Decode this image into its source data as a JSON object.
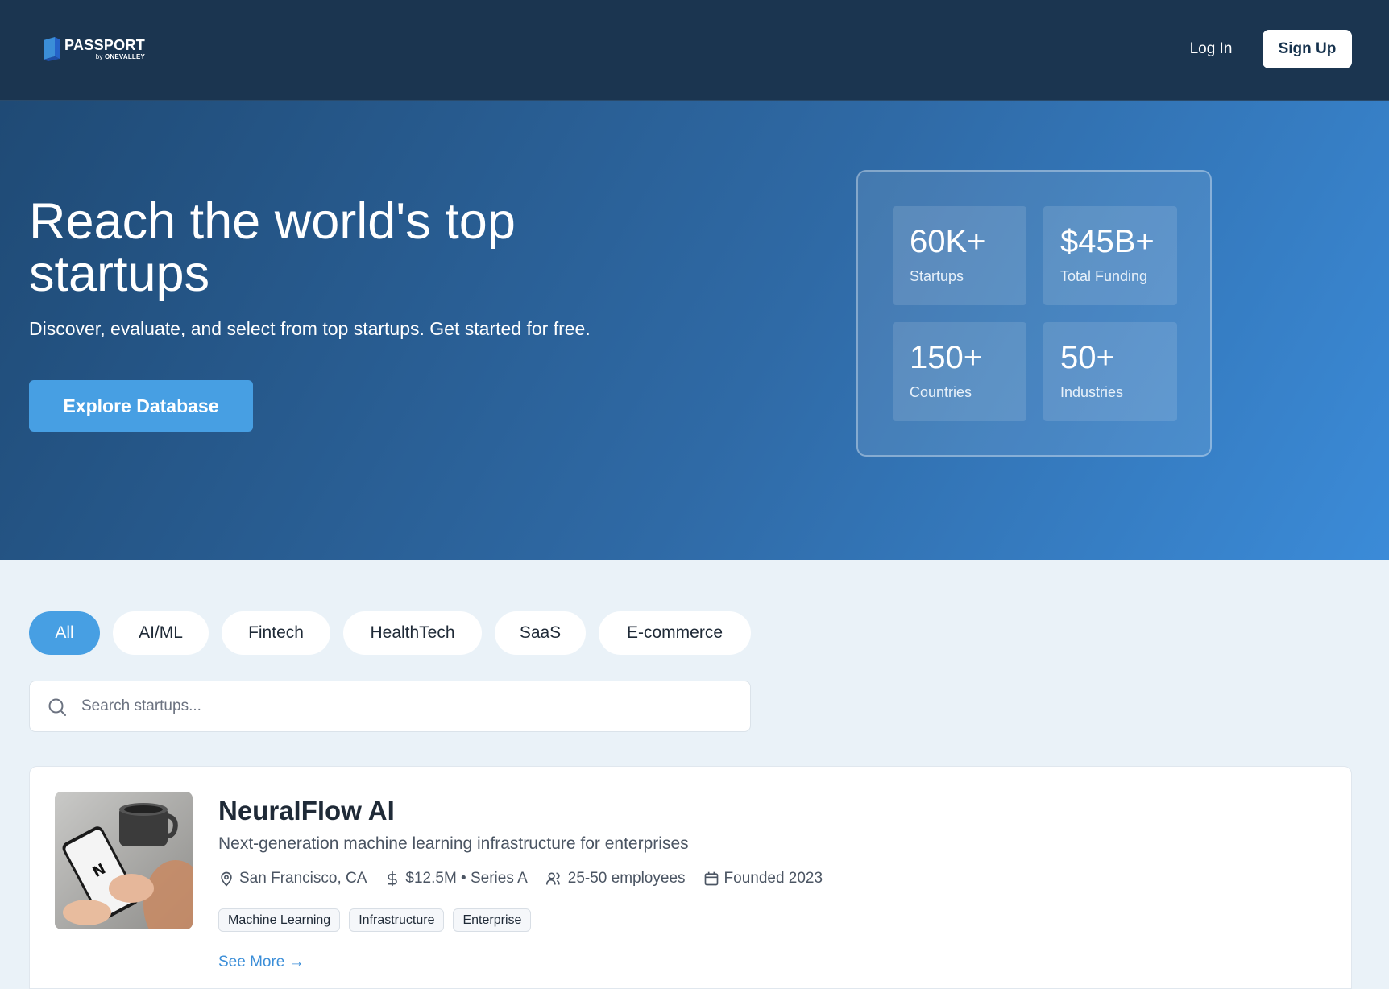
{
  "nav": {
    "brand": "PASSPORT",
    "brand_sub_prefix": "by",
    "brand_sub_strong": "ONEVALLEY",
    "login_label": "Log In",
    "signup_label": "Sign Up"
  },
  "hero": {
    "title": "Reach the world's top startups",
    "subtitle": "Discover, evaluate, and select from top startups. Get started for free.",
    "cta_label": "Explore Database",
    "stats": [
      {
        "value": "60K+",
        "label": "Startups"
      },
      {
        "value": "$45B+",
        "label": "Total Funding"
      },
      {
        "value": "150+",
        "label": "Countries"
      },
      {
        "value": "50+",
        "label": "Industries"
      }
    ]
  },
  "filters": {
    "chips": [
      "All",
      "AI/ML",
      "Fintech",
      "HealthTech",
      "SaaS",
      "E-commerce"
    ],
    "active": "All"
  },
  "search": {
    "placeholder": "Search startups...",
    "value": ""
  },
  "startups": [
    {
      "name": "NeuralFlow AI",
      "description": "Next-generation machine learning infrastructure for enterprises",
      "location": "San Francisco, CA",
      "funding": "$12.5M • Series A",
      "employees": "25-50 employees",
      "founded": "Founded 2023",
      "tags": [
        "Machine Learning",
        "Infrastructure",
        "Enterprise"
      ],
      "see_more_label": "See More →"
    }
  ],
  "colors": {
    "nav_bg": "#1b3550",
    "accent": "#479fe3",
    "link": "#3b8ed8",
    "page_bg": "#eaf2f8"
  }
}
